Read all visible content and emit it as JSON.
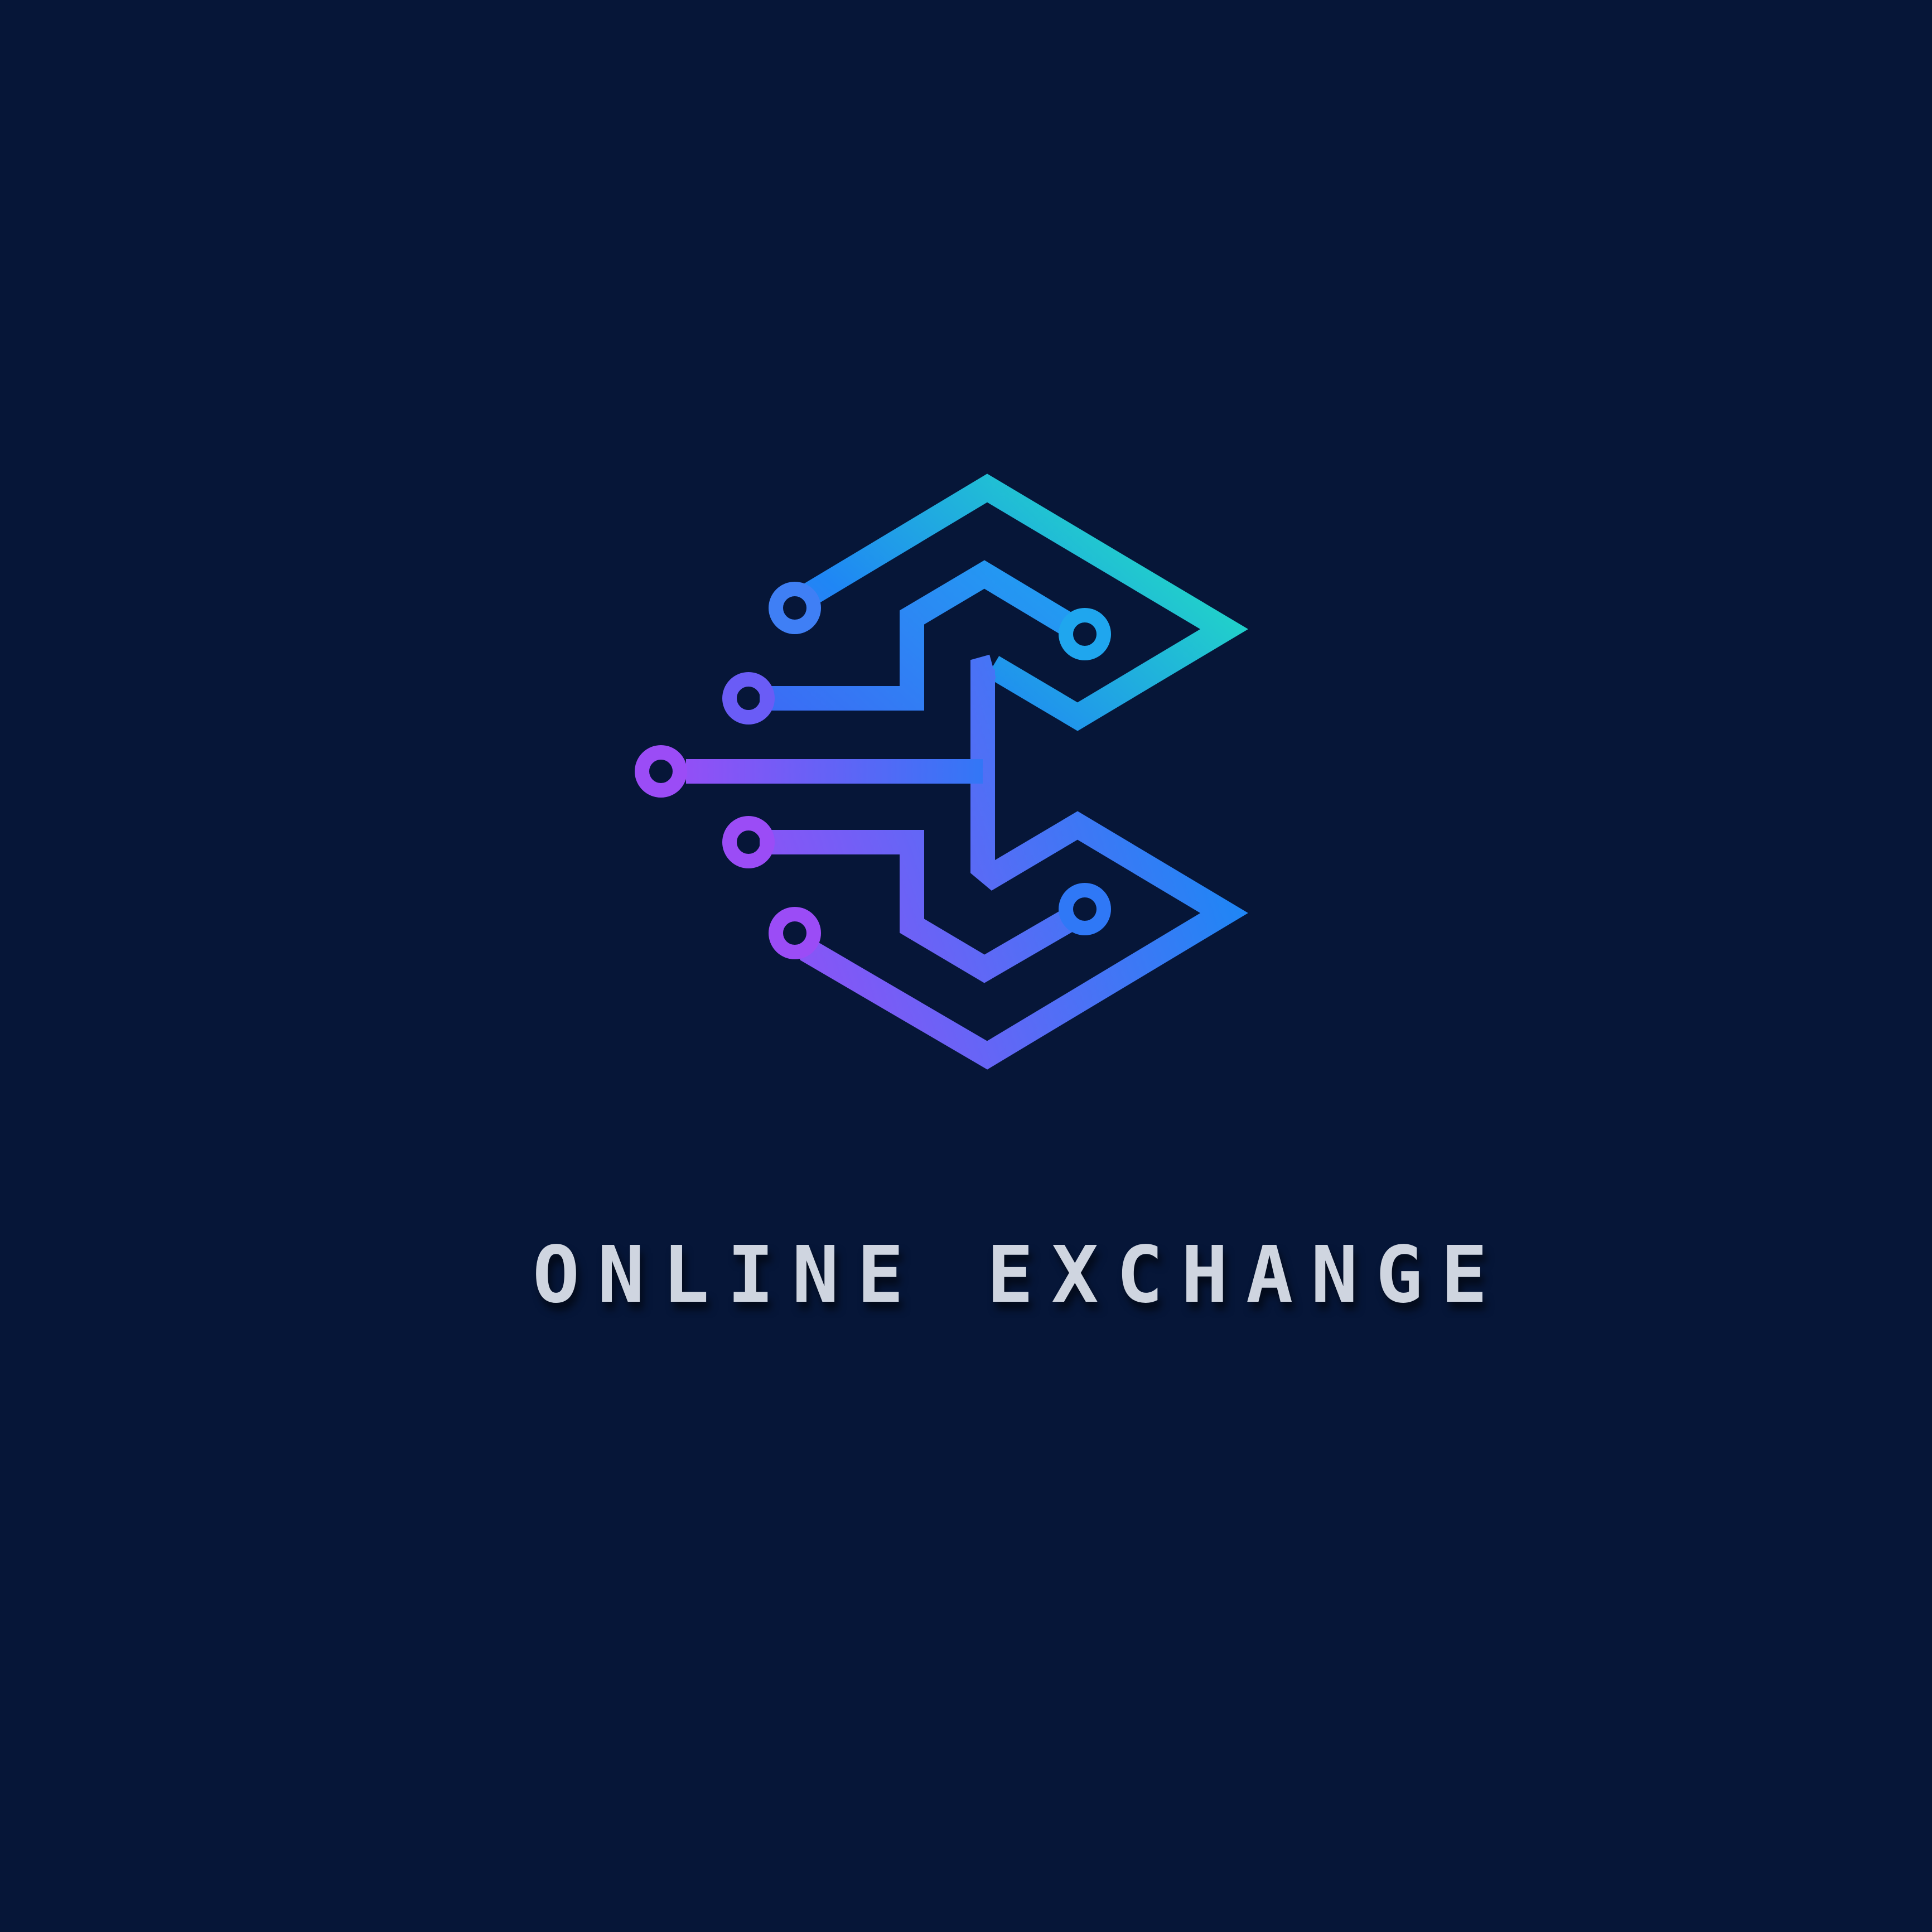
{
  "brand": {
    "wordmark": "ONLINE EXCHANGE",
    "icon": "circuit-letter-e-icon"
  },
  "colors": {
    "background": "#061638",
    "wordmark": "#cfd5e0",
    "gradient_top": "#22f0b8",
    "gradient_mid": "#1f86f5",
    "gradient_bottom": "#9b4cf6"
  }
}
